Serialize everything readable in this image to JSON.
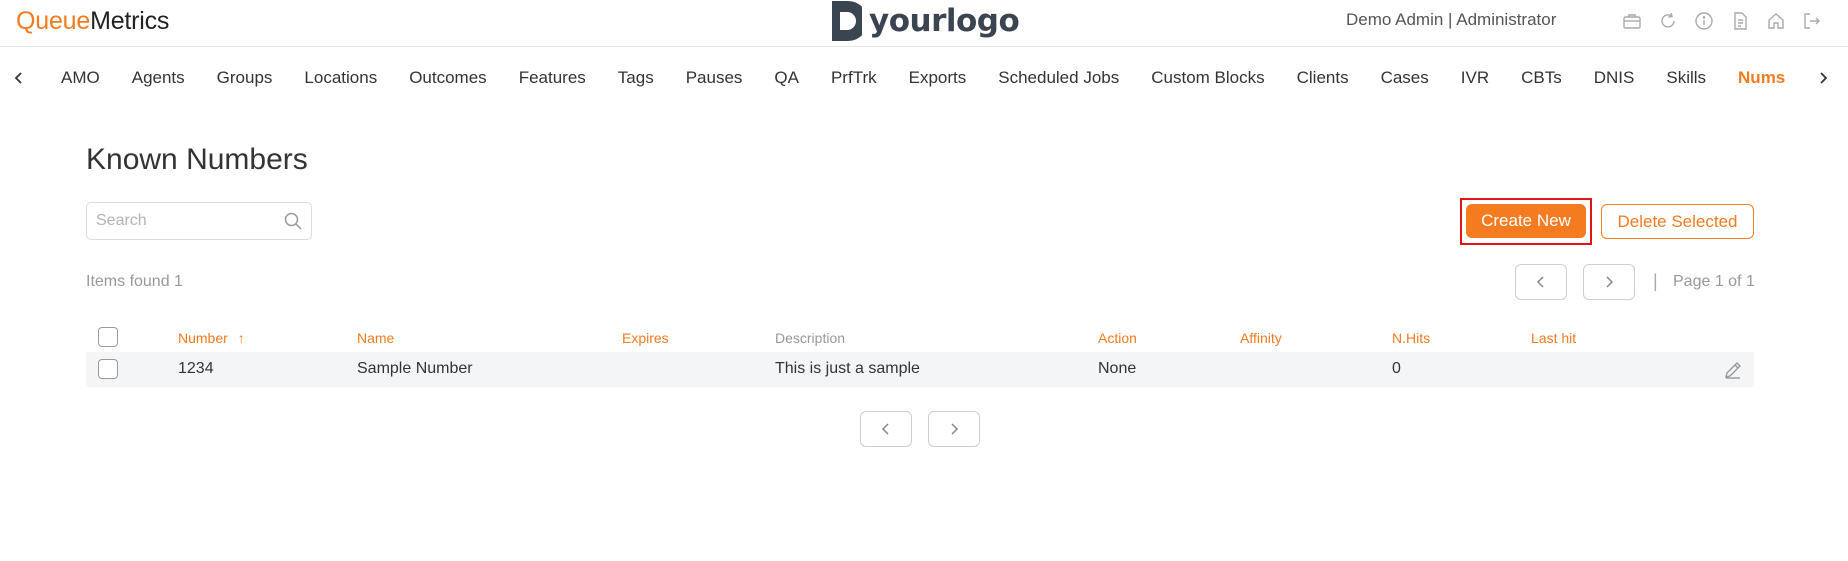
{
  "header": {
    "brand_part1": "Queue",
    "brand_part2": "Metrics",
    "logo_text": "yourlogo",
    "user": "Demo Admin | Administrator",
    "icons": [
      "briefcase-icon",
      "refresh-icon",
      "info-icon",
      "document-icon",
      "home-icon",
      "logout-icon"
    ]
  },
  "nav": {
    "items": [
      "AMO",
      "Agents",
      "Groups",
      "Locations",
      "Outcomes",
      "Features",
      "Tags",
      "Pauses",
      "QA",
      "PrfTrk",
      "Exports",
      "Scheduled Jobs",
      "Custom Blocks",
      "Clients",
      "Cases",
      "IVR",
      "CBTs",
      "DNIS",
      "Skills",
      "Nums"
    ],
    "active": "Nums"
  },
  "main": {
    "title": "Known Numbers",
    "search_placeholder": "Search",
    "create_label": "Create New",
    "delete_label": "Delete Selected",
    "items_found": "Items found 1",
    "pager_sep": "|",
    "page_info": "Page 1 of 1"
  },
  "table": {
    "columns": [
      "Number",
      "Name",
      "Expires",
      "Description",
      "Action",
      "Affinity",
      "N.Hits",
      "Last hit"
    ],
    "sort_indicator": "↑",
    "rows": [
      {
        "number": "1234",
        "name": "Sample Number",
        "expires": "",
        "description": "This is just a sample",
        "action": "None",
        "affinity": "",
        "nhits": "0",
        "last_hit": ""
      }
    ]
  },
  "colors": {
    "accent": "#f47b20",
    "highlight": "#e31414"
  }
}
